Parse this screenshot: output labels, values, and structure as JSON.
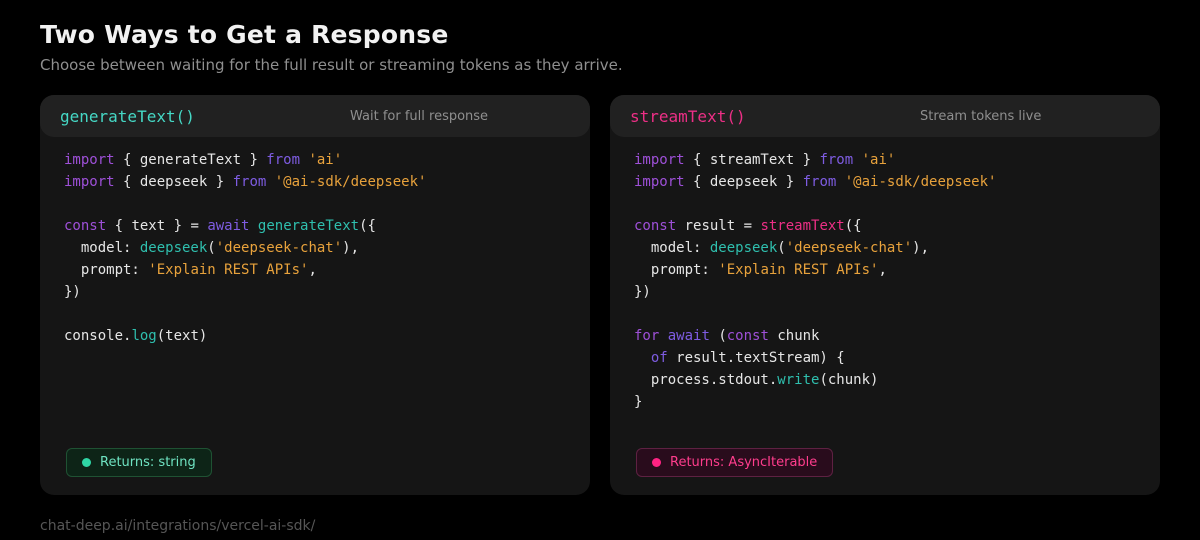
{
  "page": {
    "title": "Two Ways to Get a Response",
    "subtitle": "Choose between waiting for the full result or streaming tokens as they arrive.",
    "footer_url": "chat-deep.ai/integrations/vercel-ai-sdk/"
  },
  "colors": {
    "background": "#000000",
    "card_body": "#151515",
    "card_header": "#212121",
    "accent_teal": "#45d8c5",
    "accent_pink": "#ed2f86",
    "keyword_purple": "#9e50d8",
    "keyword_indigo": "#7e5ce2",
    "function_teal": "#2fbfae",
    "string_orange": "#e8a23c",
    "badge_green_bg": "#0d2417",
    "badge_pink_bg": "#290c1c"
  },
  "cards": [
    {
      "header": {
        "title": "generateText()",
        "label": "Wait for full response"
      },
      "badge": {
        "label": "Returns: string"
      },
      "code_lines": [
        [
          {
            "t": "kw",
            "v": "import"
          },
          {
            "t": "pln",
            "v": " { generateText } "
          },
          {
            "t": "kw2",
            "v": "from"
          },
          {
            "t": "pln",
            "v": " "
          },
          {
            "t": "str",
            "v": "'ai'"
          }
        ],
        [
          {
            "t": "kw",
            "v": "import"
          },
          {
            "t": "pln",
            "v": " { deepseek } "
          },
          {
            "t": "kw2",
            "v": "from"
          },
          {
            "t": "pln",
            "v": " "
          },
          {
            "t": "str",
            "v": "'@ai-sdk/deepseek'"
          }
        ],
        [],
        [
          {
            "t": "kw",
            "v": "const"
          },
          {
            "t": "pln",
            "v": " { text } = "
          },
          {
            "t": "kw2",
            "v": "await"
          },
          {
            "t": "pln",
            "v": " "
          },
          {
            "t": "fn",
            "v": "generateText"
          },
          {
            "t": "pln",
            "v": "({"
          }
        ],
        [
          {
            "t": "pln",
            "v": "  model: "
          },
          {
            "t": "fn",
            "v": "deepseek"
          },
          {
            "t": "pln",
            "v": "("
          },
          {
            "t": "str",
            "v": "'deepseek-chat'"
          },
          {
            "t": "pln",
            "v": "),"
          }
        ],
        [
          {
            "t": "pln",
            "v": "  prompt: "
          },
          {
            "t": "str",
            "v": "'Explain REST APIs'"
          },
          {
            "t": "pln",
            "v": ","
          }
        ],
        [
          {
            "t": "pln",
            "v": "})"
          }
        ],
        [],
        [
          {
            "t": "pln",
            "v": "console."
          },
          {
            "t": "fn",
            "v": "log"
          },
          {
            "t": "pln",
            "v": "(text)"
          }
        ]
      ]
    },
    {
      "header": {
        "title": "streamText()",
        "label": "Stream tokens live"
      },
      "badge": {
        "label": "Returns: AsyncIterable"
      },
      "code_lines": [
        [
          {
            "t": "kw",
            "v": "import"
          },
          {
            "t": "pln",
            "v": " { streamText } "
          },
          {
            "t": "kw2",
            "v": "from"
          },
          {
            "t": "pln",
            "v": " "
          },
          {
            "t": "str",
            "v": "'ai'"
          }
        ],
        [
          {
            "t": "kw",
            "v": "import"
          },
          {
            "t": "pln",
            "v": " { deepseek } "
          },
          {
            "t": "kw2",
            "v": "from"
          },
          {
            "t": "pln",
            "v": " "
          },
          {
            "t": "str",
            "v": "'@ai-sdk/deepseek'"
          }
        ],
        [],
        [
          {
            "t": "kw",
            "v": "const"
          },
          {
            "t": "pln",
            "v": " result = "
          },
          {
            "t": "fnp",
            "v": "streamText"
          },
          {
            "t": "pln",
            "v": "({"
          }
        ],
        [
          {
            "t": "pln",
            "v": "  model: "
          },
          {
            "t": "fn",
            "v": "deepseek"
          },
          {
            "t": "pln",
            "v": "("
          },
          {
            "t": "str",
            "v": "'deepseek-chat'"
          },
          {
            "t": "pln",
            "v": "),"
          }
        ],
        [
          {
            "t": "pln",
            "v": "  prompt: "
          },
          {
            "t": "str",
            "v": "'Explain REST APIs'"
          },
          {
            "t": "pln",
            "v": ","
          }
        ],
        [
          {
            "t": "pln",
            "v": "})"
          }
        ],
        [],
        [
          {
            "t": "kw",
            "v": "for"
          },
          {
            "t": "pln",
            "v": " "
          },
          {
            "t": "kw2",
            "v": "await"
          },
          {
            "t": "pln",
            "v": " ("
          },
          {
            "t": "kw",
            "v": "const"
          },
          {
            "t": "pln",
            "v": " chunk"
          }
        ],
        [
          {
            "t": "pln",
            "v": "  "
          },
          {
            "t": "kw2",
            "v": "of"
          },
          {
            "t": "pln",
            "v": " result.textStream) {"
          }
        ],
        [
          {
            "t": "pln",
            "v": "  process.stdout."
          },
          {
            "t": "fn",
            "v": "write"
          },
          {
            "t": "pln",
            "v": "(chunk)"
          }
        ],
        [
          {
            "t": "pln",
            "v": "}"
          }
        ]
      ]
    }
  ]
}
